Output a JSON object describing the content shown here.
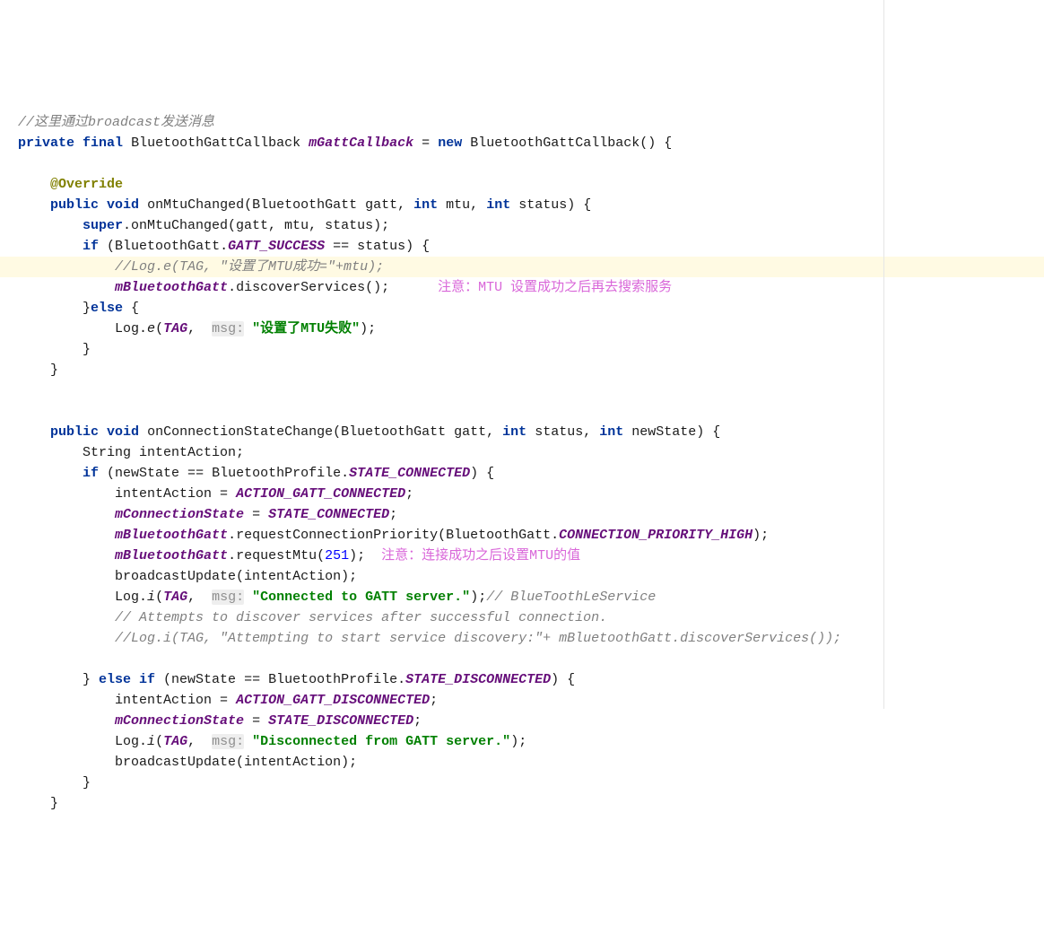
{
  "lines": {
    "l1": "//这里通过broadcast发送消息",
    "l2a": "private",
    "l2b": "final",
    "l2c": "BluetoothGattCallback",
    "l2d": "mGattCallback",
    "l2e": "=",
    "l2f": "new",
    "l2g": "BluetoothGattCallback() {",
    "l3": "@Override",
    "l4a": "public",
    "l4b": "void",
    "l4c": "onMtuChanged(BluetoothGatt gatt,",
    "l4d": "int",
    "l4e": "mtu,",
    "l4f": "int",
    "l4g": "status) {",
    "l5a": "super",
    "l5b": ".onMtuChanged(gatt, mtu, status);",
    "l6a": "if",
    "l6b": "(BluetoothGatt.",
    "l6c": "GATT_SUCCESS",
    "l6d": " == status) {",
    "l7": "//Log.e(TAG, \"设置了MTU成功=\"+mtu);",
    "l8a": "mBluetoothGatt",
    "l8b": ".discoverServices();",
    "l8c": "注意：MTU 设置成功之后再去搜索服务",
    "l9a": "}",
    "l9b": "else",
    "l9c": " {",
    "l10a": "Log.",
    "l10b": "e",
    "l10c": "(",
    "l10d": "TAG",
    "l10e": ",  ",
    "l10f": "msg:",
    "l10g": "\"设置了MTU失败\"",
    "l10h": ");",
    "l11": "}",
    "l12": "}",
    "l13a": "public",
    "l13b": "void",
    "l13c": "onConnectionStateChange(BluetoothGatt gatt,",
    "l13d": "int",
    "l13e": "status,",
    "l13f": "int",
    "l13g": "newState) {",
    "l14": "String intentAction;",
    "l15a": "if",
    "l15b": "(newState == BluetoothProfile.",
    "l15c": "STATE_CONNECTED",
    "l15d": ") {",
    "l16a": "intentAction = ",
    "l16b": "ACTION_GATT_CONNECTED",
    "l16c": ";",
    "l17a": "mConnectionState",
    "l17b": " = ",
    "l17c": "STATE_CONNECTED",
    "l17d": ";",
    "l18a": "mBluetoothGatt",
    "l18b": ".requestConnectionPriority(BluetoothGatt.",
    "l18c": "CONNECTION_PRIORITY_HIGH",
    "l18d": ");",
    "l19a": "mBluetoothGatt",
    "l19b": ".requestMtu(",
    "l19c": "251",
    "l19d": ");  ",
    "l19e": "注意：连接成功之后设置MTU的值",
    "l20": "broadcastUpdate(intentAction);",
    "l21a": "Log.",
    "l21b": "i",
    "l21c": "(",
    "l21d": "TAG",
    "l21e": ",  ",
    "l21f": "msg:",
    "l21g": "\"Connected to GATT server.\"",
    "l21h": ");",
    "l21i": "// BlueToothLeService",
    "l22": "// Attempts to discover services after successful connection.",
    "l23": "//Log.i(TAG, \"Attempting to start service discovery:\"+ mBluetoothGatt.discoverServices());",
    "l24a": "} ",
    "l24b": "else if",
    "l24c": " (newState == BluetoothProfile.",
    "l24d": "STATE_DISCONNECTED",
    "l24e": ") {",
    "l25a": "intentAction = ",
    "l25b": "ACTION_GATT_DISCONNECTED",
    "l25c": ";",
    "l26a": "mConnectionState",
    "l26b": " = ",
    "l26c": "STATE_DISCONNECTED",
    "l26d": ";",
    "l27a": "Log.",
    "l27b": "i",
    "l27c": "(",
    "l27d": "TAG",
    "l27e": ",  ",
    "l27f": "msg:",
    "l27g": "\"Disconnected from GATT server.\"",
    "l27h": ");",
    "l28": "broadcastUpdate(intentAction);",
    "l29": "}",
    "l30": "}"
  }
}
